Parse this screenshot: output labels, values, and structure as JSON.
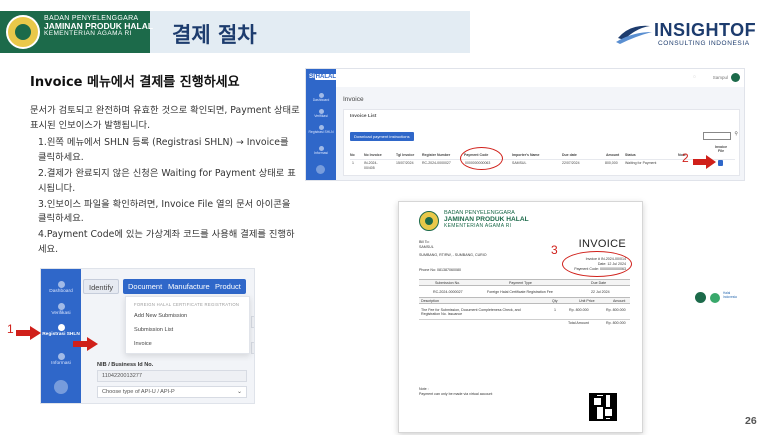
{
  "header": {
    "org_line1": "BADAN PENYELENGGARA",
    "org_line2": "JAMINAN PRODUK HALAL",
    "org_line3": "KEMENTERIAN AGAMA RI",
    "title": "결제 절차",
    "brand_name": "INSIGHTOF",
    "brand_sub": "CONSULTING INDONESIA",
    "band_color": "#e3ecf3",
    "title_color": "#1d3c6e"
  },
  "slide": {
    "heading": "Invoice 메뉴에서 결제를 진행하세요",
    "intro": "문서가 검토되고 완전하며 유효한 것으로 확인되면, Payment 상태로 표시된 인보이스가 발행됩니다.",
    "steps": [
      "1.왼쪽 메뉴에서 SHLN 등록 (Registrasi SHLN) → Invoice를 클릭하세요.",
      "2.결제가 완료되지 않은 신청은 Waiting for Payment 상태로 표시됩니다.",
      "3.인보이스 파일을 확인하려면, Invoice File 열의 문서 아이콘을 클릭하세요.",
      "4.Payment Code에 있는 가상계좌 코드를 사용해 결제를 진행하세요."
    ],
    "page_number": "26"
  },
  "screenshot_menu": {
    "sidebar": [
      {
        "label": "Dashboard",
        "icon": "home-icon"
      },
      {
        "label": "Verifikasi",
        "icon": "check-icon"
      },
      {
        "label": "Registrasi SHLN",
        "icon": "gear-icon",
        "active": true
      },
      {
        "label": "Informasi",
        "icon": "info-icon"
      }
    ],
    "tabs": [
      "Identify",
      "Document",
      "Manufacture",
      "Product"
    ],
    "menu_heading": "FOREIGN HALAL CERTIFICATE REGISTRATION",
    "menu_items": [
      "Add New Submission",
      "Submission List",
      "Invoice"
    ],
    "nib_label": "NIB / Business Id No.",
    "nib_value": "1104220013277",
    "select_value": "Choose type of API-U / API-P",
    "accent_color": "#2f67c9"
  },
  "screenshot_invoice_list": {
    "logo": "SI",
    "logo_badge": "HALAL",
    "sidebar": [
      "Dashboard",
      "Verifikasi",
      "Registrasi SHLN",
      "Informasi"
    ],
    "user": "Sampul",
    "page_title": "Invoice",
    "card_title": "Invoice List",
    "download_button": "Download payment instructions",
    "columns": [
      "No",
      "No Invoice",
      "Tgl Invoice",
      "Register Number",
      "Payment Code",
      "Importer's Name",
      "Due date",
      "Amount",
      "Status",
      "Note",
      "Invoice File"
    ],
    "row": {
      "no": "1",
      "no_invoice": "IN-2024-",
      "no_invoice_2": "00/405",
      "tgl_invoice": "15/07/2024",
      "register_number": "RC-2024-0000027",
      "payment_code": "0000000000063",
      "importer": "SAMSUL",
      "due_date": "22/07/2024",
      "amount": "800,000",
      "status": "Waiting for Payment"
    }
  },
  "invoice_doc": {
    "title": "INVOICE",
    "bill_to_label": "Bill To:",
    "bill_to_name": "SAMSUL",
    "address": "SUMBANG, RT/RW, - SUMBANG, CURIO",
    "phone": "Phone No: 081387060080",
    "invoice_no": "Invoice # IN-2024-00/014",
    "date": "Date: 12 Jul 2024",
    "payment_code": "Payment Code: 0000000000063",
    "sub_headers": [
      "Submission No.",
      "Payment Type",
      "Due Date"
    ],
    "sub_values": [
      "RC-2024-0000027",
      "Foreign Halal Certificate Registration Fee",
      "22 Jul 2024"
    ],
    "item_headers": [
      "Description",
      "Qty",
      "Unit Price",
      "Amount"
    ],
    "item_description": "The Fee for Submission, Document Completeness Check, and Registration No. Issuance",
    "item_qty": "1",
    "item_unit_price": "Rp. 800.000",
    "item_amount": "Rp. 800.000",
    "total_label": "Total Amount",
    "total_value": "Rp. 800.000",
    "note_label": "Note :",
    "note_text": "Payment can only be made via virtual account"
  },
  "annotations": {
    "n1": "1",
    "n2": "2",
    "n3": "3",
    "color": "#d0201a"
  },
  "footer": {
    "logo_text": "Halal Indonesia"
  }
}
